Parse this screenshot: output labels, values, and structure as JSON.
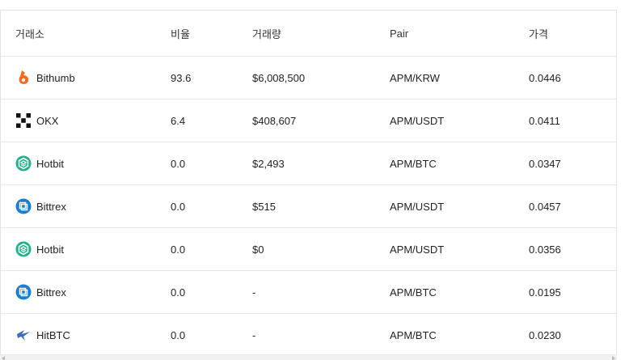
{
  "table": {
    "headers": {
      "exchange": "거래소",
      "ratio": "비율",
      "volume": "거래량",
      "pair": "Pair",
      "price": "가격"
    },
    "rows": [
      {
        "exchange": "Bithumb",
        "icon": "bithumb-icon",
        "ratio": "93.6",
        "volume": "$6,008,500",
        "pair": "APM/KRW",
        "price": "0.0446"
      },
      {
        "exchange": "OKX",
        "icon": "okx-icon",
        "ratio": "6.4",
        "volume": "$408,607",
        "pair": "APM/USDT",
        "price": "0.0411"
      },
      {
        "exchange": "Hotbit",
        "icon": "hotbit-icon",
        "ratio": "0.0",
        "volume": "$2,493",
        "pair": "APM/BTC",
        "price": "0.0347"
      },
      {
        "exchange": "Bittrex",
        "icon": "bittrex-icon",
        "ratio": "0.0",
        "volume": "$515",
        "pair": "APM/USDT",
        "price": "0.0457"
      },
      {
        "exchange": "Hotbit",
        "icon": "hotbit-icon",
        "ratio": "0.0",
        "volume": "$0",
        "pair": "APM/USDT",
        "price": "0.0356"
      },
      {
        "exchange": "Bittrex",
        "icon": "bittrex-icon",
        "ratio": "0.0",
        "volume": "-",
        "pair": "APM/BTC",
        "price": "0.0195"
      },
      {
        "exchange": "HitBTC",
        "icon": "hitbtc-icon",
        "ratio": "0.0",
        "volume": "-",
        "pair": "APM/BTC",
        "price": "0.0230"
      }
    ]
  },
  "colors": {
    "bithumb": "#f26d21",
    "okx": "#111111",
    "hotbit": "#20b18a",
    "bittrex": "#1a7fd0",
    "hitbtc": "#3b6fb6"
  }
}
